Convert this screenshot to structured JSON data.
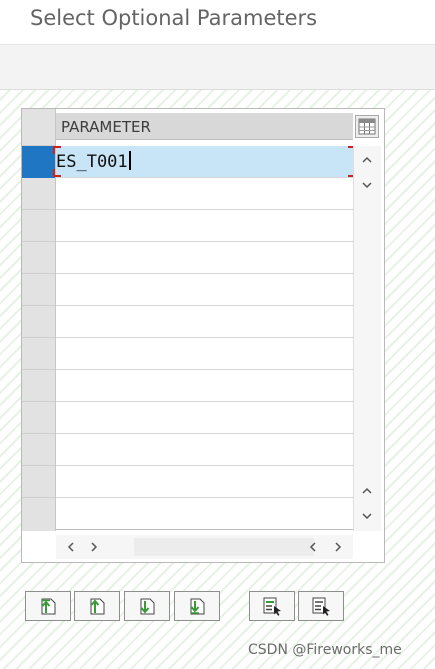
{
  "dialog": {
    "title": "Select Optional Parameters"
  },
  "grid": {
    "column_header": "PARAMETER",
    "rows": [
      "ES_T001",
      "",
      "",
      "",
      "",
      "",
      "",
      "",
      "",
      "",
      "",
      ""
    ],
    "selected_row": 0
  },
  "toolbar_buttons": [
    {
      "name": "move-to-top-button",
      "icon": "arrow-up-to-top-icon"
    },
    {
      "name": "move-up-button",
      "icon": "arrow-up-icon"
    },
    {
      "name": "move-down-button",
      "icon": "arrow-down-icon"
    },
    {
      "name": "move-to-bottom-button",
      "icon": "arrow-down-to-bottom-icon"
    },
    {
      "name": "select-all-button",
      "icon": "select-all-icon"
    },
    {
      "name": "deselect-all-button",
      "icon": "deselect-all-icon"
    }
  ],
  "watermark": {
    "text": "CSDN @Fireworks_me"
  },
  "colors": {
    "selection_blue": "#1f77c4",
    "selected_row_bg": "#c8e4f7",
    "arrow_green": "#3a9a3a",
    "bracket_red": "#cc2222"
  }
}
